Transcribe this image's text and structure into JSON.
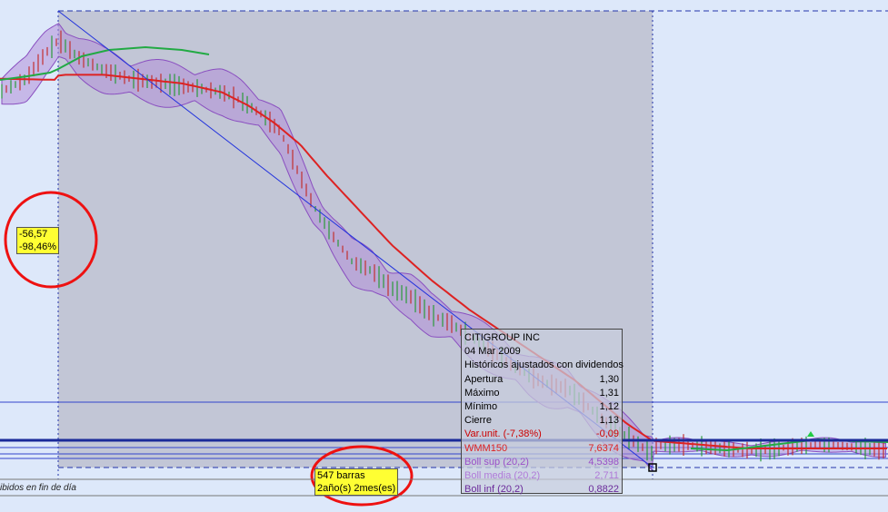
{
  "chart_data": {
    "type": "candlestick",
    "security": "CITIGROUP INC",
    "series": [
      {
        "name": "WMM150",
        "color": "#dd2222"
      },
      {
        "name": "Boll sup (20,2)",
        "color": "#9a4fc8"
      },
      {
        "name": "Boll media (20,2)",
        "color": "#b07ad8"
      },
      {
        "name": "Boll inf (20,2)",
        "color": "#6a2a9a"
      }
    ],
    "price_path": [
      [
        0,
        0.83
      ],
      [
        0.04,
        0.86
      ],
      [
        0.07,
        0.92
      ],
      [
        0.09,
        0.95
      ],
      [
        0.12,
        0.91
      ],
      [
        0.16,
        0.88
      ],
      [
        0.2,
        0.86
      ],
      [
        0.25,
        0.85
      ],
      [
        0.3,
        0.84
      ],
      [
        0.34,
        0.83
      ],
      [
        0.37,
        0.81
      ],
      [
        0.4,
        0.78
      ],
      [
        0.43,
        0.74
      ],
      [
        0.45,
        0.67
      ],
      [
        0.48,
        0.57
      ],
      [
        0.51,
        0.5
      ],
      [
        0.54,
        0.44
      ],
      [
        0.57,
        0.42
      ],
      [
        0.6,
        0.38
      ],
      [
        0.63,
        0.36
      ],
      [
        0.66,
        0.32
      ],
      [
        0.69,
        0.3
      ],
      [
        0.72,
        0.27
      ],
      [
        0.75,
        0.24
      ],
      [
        0.78,
        0.21
      ],
      [
        0.81,
        0.18
      ],
      [
        0.84,
        0.16
      ],
      [
        0.87,
        0.15
      ],
      [
        0.9,
        0.11
      ],
      [
        0.93,
        0.07
      ],
      [
        0.96,
        0.04
      ],
      [
        1.0,
        0.0
      ]
    ],
    "wmm_path": [
      [
        0,
        0.84
      ],
      [
        0.05,
        0.86
      ],
      [
        0.1,
        0.87
      ],
      [
        0.16,
        0.87
      ],
      [
        0.22,
        0.86
      ],
      [
        0.28,
        0.85
      ],
      [
        0.34,
        0.83
      ],
      [
        0.38,
        0.8
      ],
      [
        0.42,
        0.76
      ],
      [
        0.46,
        0.71
      ],
      [
        0.5,
        0.64
      ],
      [
        0.55,
        0.56
      ],
      [
        0.6,
        0.48
      ],
      [
        0.66,
        0.4
      ],
      [
        0.72,
        0.33
      ],
      [
        0.78,
        0.27
      ],
      [
        0.84,
        0.21
      ],
      [
        0.88,
        0.17
      ],
      [
        0.92,
        0.12
      ],
      [
        0.96,
        0.07
      ],
      [
        1.0,
        0.03
      ]
    ]
  },
  "annotations": {
    "change_value": "-56,57",
    "change_pct": "-98,46%",
    "bars_count": "547 barras",
    "duration": "2año(s) 2mes(es)"
  },
  "info_panel": {
    "title": "CITIGROUP INC",
    "date": "04 Mar 2009",
    "subtitle": "Históricos ajustados con dividendos",
    "rows": [
      {
        "label": "Apertura",
        "value": "1,30",
        "color": "#000000"
      },
      {
        "label": "Máximo",
        "value": "1,31",
        "color": "#000000"
      },
      {
        "label": "Mínimo",
        "value": "1,12",
        "color": "#000000"
      },
      {
        "label": "Cierre",
        "value": "1,13",
        "color": "#000000"
      },
      {
        "label": "Var.unit. (-7,38%)",
        "value": "-0,09",
        "color": "#cc0000"
      },
      {
        "label": "WMM150",
        "value": "7,6374",
        "color": "#dd2222"
      },
      {
        "label": "Boll sup (20,2)",
        "value": "4,5398",
        "color": "#9a4fc8"
      },
      {
        "label": "Boll media (20,2)",
        "value": "2,711",
        "color": "#b07ad8"
      },
      {
        "label": "Boll inf (20,2)",
        "value": "0,8822",
        "color": "#6a2a9a"
      }
    ]
  },
  "footer_text": "ibidos en fin de día"
}
